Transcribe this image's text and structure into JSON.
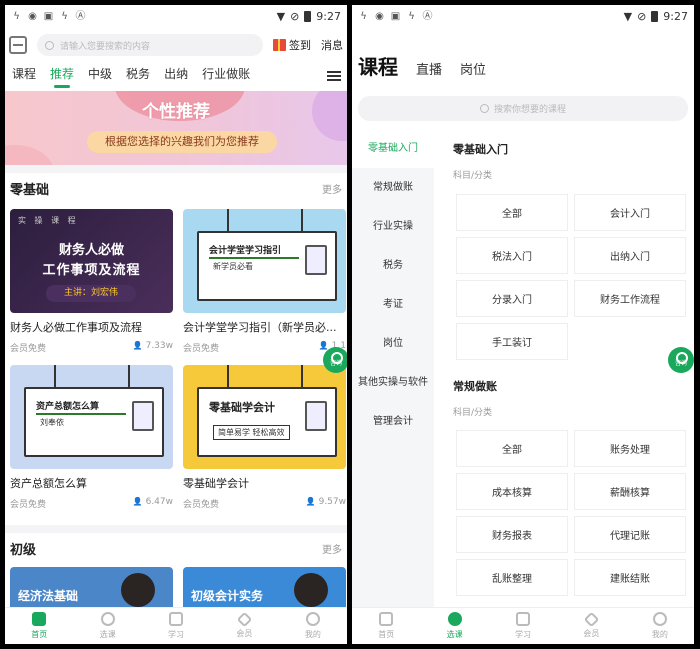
{
  "status": {
    "time": "9:27"
  },
  "home": {
    "search_placeholder": "请输入您要搜索的内容",
    "sign_in": "签到",
    "messages": "消息",
    "tabs": [
      "课程",
      "推荐",
      "中级",
      "税务",
      "出纳",
      "行业做账"
    ],
    "active_tab": "推荐",
    "banner_title": "个性推荐",
    "banner_subtitle": "根据您选择的兴趣我们为您推荐",
    "section1": {
      "title": "零基础",
      "more": "更多"
    },
    "section2": {
      "title": "初级",
      "more": "更多"
    },
    "cards": [
      {
        "title": "财务人必做工作事项及流程",
        "tag": "会员免费",
        "views": "7.33w",
        "thumb_l1": "实 操 课 程",
        "thumb_l2": "财务人必做",
        "thumb_l3": "工作事项及流程",
        "thumb_l4": "主讲：刘宏伟"
      },
      {
        "title": "会计学堂学习指引（新学员必...",
        "tag": "会员免费",
        "views": "1.1",
        "thumb_title": "会计学堂学习指引",
        "thumb_sub": "新学员必看"
      },
      {
        "title": "资产总额怎么算",
        "tag": "会员免费",
        "views": "6.47w",
        "thumb_title": "资产总额怎么算",
        "thumb_sub": "刘奉依"
      },
      {
        "title": "零基础学会计",
        "tag": "会员免费",
        "views": "9.57w",
        "thumb_title": "零基础学会计",
        "thumb_sub": "简单易学 轻松高效"
      }
    ],
    "cards2": [
      {
        "thumb_title": "经济法基础"
      },
      {
        "thumb_title": "初级会计实务"
      }
    ],
    "consult": "咨询"
  },
  "catalog": {
    "tabs": [
      "课程",
      "直播",
      "岗位"
    ],
    "search_placeholder": "搜索你想要的课程",
    "left_nav": [
      "零基础入门",
      "常规做账",
      "行业实操",
      "税务",
      "考证",
      "岗位",
      "其他实操与软件",
      "管理会计"
    ],
    "active_nav": "零基础入门",
    "sections": [
      {
        "title": "零基础入门",
        "sub": "科目/分类",
        "items": [
          "全部",
          "会计入门",
          "税法入门",
          "出纳入门",
          "分录入门",
          "财务工作流程",
          "手工装订"
        ]
      },
      {
        "title": "常规做账",
        "sub": "科目/分类",
        "items": [
          "全部",
          "账务处理",
          "成本核算",
          "薪酬核算",
          "财务报表",
          "代理记账",
          "乱账整理",
          "建账结账"
        ]
      }
    ],
    "consult": "咨询"
  },
  "bottom_nav": [
    "首页",
    "选课",
    "学习",
    "会员",
    "我的"
  ],
  "colors": {
    "accent": "#1aa85c"
  }
}
